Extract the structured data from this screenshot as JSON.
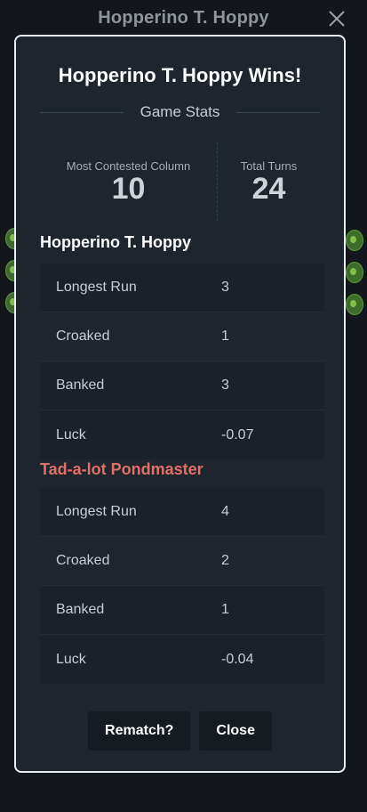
{
  "background": {
    "title": "Hopperino T. Hoppy",
    "close_icon": "close-icon"
  },
  "modal": {
    "title": "Hopperino T. Hoppy Wins!",
    "section_label": "Game Stats",
    "summary": {
      "most_contested_label": "Most Contested Column",
      "most_contested_value": "10",
      "total_turns_label": "Total Turns",
      "total_turns_value": "24"
    },
    "players": [
      {
        "name": "Hopperino T. Hoppy",
        "color": "#ffffff",
        "stats": [
          {
            "label": "Longest Run",
            "value": "3"
          },
          {
            "label": "Croaked",
            "value": "1"
          },
          {
            "label": "Banked",
            "value": "3"
          },
          {
            "label": "Luck",
            "value": "-0.07"
          }
        ]
      },
      {
        "name": "Tad-a-lot Pondmaster",
        "color": "#e06f6a",
        "stats": [
          {
            "label": "Longest Run",
            "value": "4"
          },
          {
            "label": "Croaked",
            "value": "2"
          },
          {
            "label": "Banked",
            "value": "1"
          },
          {
            "label": "Luck",
            "value": "-0.04"
          }
        ]
      }
    ],
    "buttons": {
      "rematch": "Rematch?",
      "close": "Close"
    }
  }
}
